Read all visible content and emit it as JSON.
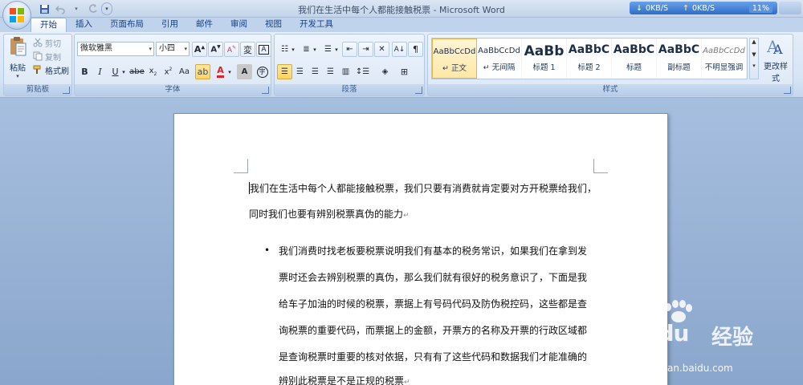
{
  "window": {
    "title": "我们在生活中每个人都能接触税票 - Microsoft Word"
  },
  "netspeed": {
    "down": "0KB/S",
    "up": "0KB/S",
    "percent": "11%"
  },
  "tabs": [
    "开始",
    "插入",
    "页面布局",
    "引用",
    "邮件",
    "审阅",
    "视图",
    "开发工具"
  ],
  "active_tab": "开始",
  "clipboard": {
    "group_label": "剪贴板",
    "paste_label": "粘贴",
    "cut_label": "剪切",
    "copy_label": "复制",
    "format_painter_label": "格式刷"
  },
  "font": {
    "group_label": "字体",
    "font_name": "微软雅黑",
    "font_size": "小四",
    "wen_glyph": "wén",
    "change_case": "Aa",
    "clear_format": "A",
    "char_border": "A"
  },
  "paragraph": {
    "group_label": "段落"
  },
  "styles": {
    "group_label": "样式",
    "change_styles_label": "更改样式",
    "items": [
      {
        "sample": "AaBbCcDd",
        "name": "↵ 正文"
      },
      {
        "sample": "AaBbCcDd",
        "name": "↵ 无间隔"
      },
      {
        "sample": "AaBb",
        "name": "标题 1"
      },
      {
        "sample": "AaBbC",
        "name": "标题 2"
      },
      {
        "sample": "AaBbC",
        "name": "标题"
      },
      {
        "sample": "AaBbC",
        "name": "副标题"
      },
      {
        "sample": "AaBbCcDd",
        "name": "不明显强调"
      }
    ]
  },
  "document": {
    "para1_line1": "我们在生活中每个人都能接触税票，我们只要有消费就肯定要对方开税票给我们，",
    "para1_line2": "同时我们也要有辨别税票真伪的能力",
    "bullet_lines": [
      "我们消费时找老板要税票说明我们有基本的税务常识，如果我们在拿到发",
      "票时还会去辨别税票的真伪，那么我们就有很好的税务意识了，下面是我",
      "给车子加油的时候的税票，票据上有号码代码及防伪税控码，这些都是查",
      "询税票的重要代码，而票据上的金额，开票方的名称及开票的行政区域都",
      "是查询税票时重要的核对依据，只有有了这些代码和数据我们才能准确的",
      "辨别此税票是不是正规的税票"
    ],
    "para_mark": "↵",
    "bullet_char": "•"
  },
  "watermark": {
    "brand": "Bai",
    "brand_du": "du",
    "cn": "经验",
    "url": "jingyan.baidu.com"
  },
  "colors": {
    "ribbon": "#dbe7f6",
    "tab_text": "#15428b",
    "highlight": "#ffd35e",
    "font_red": "#e02020"
  }
}
